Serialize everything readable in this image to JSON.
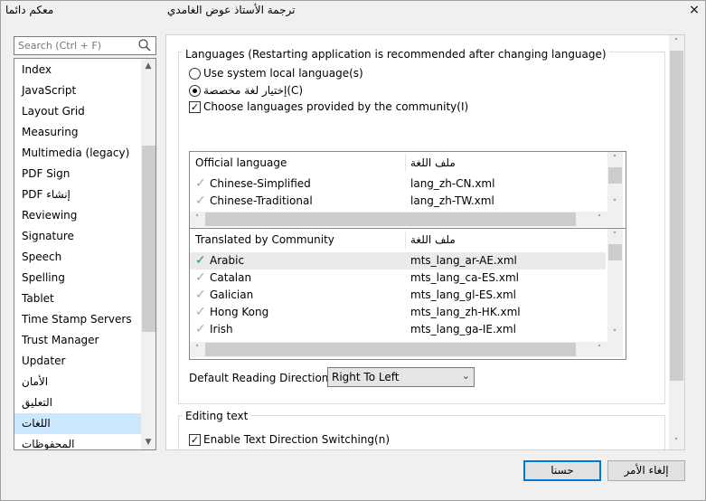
{
  "titlebar": {
    "left_title": "معكم دائما",
    "center_title": "ترجمة الأستاذ عوض الغامدي",
    "close_label": "×"
  },
  "search": {
    "placeholder": "Search (Ctrl + F)"
  },
  "nav": {
    "items": [
      {
        "label": "Index",
        "selected": false
      },
      {
        "label": "JavaScript",
        "selected": false
      },
      {
        "label": "Layout Grid",
        "selected": false
      },
      {
        "label": "Measuring",
        "selected": false
      },
      {
        "label": "Multimedia (legacy)",
        "selected": false
      },
      {
        "label": "PDF Sign",
        "selected": false
      },
      {
        "label": "PDF إنشاء",
        "selected": false
      },
      {
        "label": "Reviewing",
        "selected": false
      },
      {
        "label": "Signature",
        "selected": false
      },
      {
        "label": "Speech",
        "selected": false
      },
      {
        "label": "Spelling",
        "selected": false
      },
      {
        "label": "Tablet",
        "selected": false
      },
      {
        "label": "Time Stamp Servers",
        "selected": false
      },
      {
        "label": "Trust Manager",
        "selected": false
      },
      {
        "label": "Updater",
        "selected": false
      },
      {
        "label": "الأمان",
        "selected": false
      },
      {
        "label": "التعليق",
        "selected": false
      },
      {
        "label": "اللغات",
        "selected": true
      },
      {
        "label": "المحفوظات",
        "selected": false
      }
    ]
  },
  "languages": {
    "group_title": "Languages (Restarting application is recommended after changing language)",
    "radio_system": {
      "label": "Use system local language(s)",
      "checked": false
    },
    "radio_custom": {
      "label": "إختيار لغة مخصصة(C)",
      "checked": true
    },
    "check_community": {
      "label": "Choose languages provided by the community(I)",
      "checked": true
    },
    "official_table": {
      "headers": [
        "Official language",
        "ملف اللغة"
      ],
      "rows": [
        {
          "language": "Chinese-Simplified",
          "file": "lang_zh-CN.xml",
          "check": "gray"
        },
        {
          "language": "Chinese-Traditional",
          "file": "lang_zh-TW.xml",
          "check": "gray"
        }
      ]
    },
    "community_table": {
      "headers": [
        "Translated by Community",
        "ملف اللغة"
      ],
      "rows": [
        {
          "language": "Arabic",
          "file": "mts_lang_ar-AE.xml",
          "check": "green"
        },
        {
          "language": "Catalan",
          "file": "mts_lang_ca-ES.xml",
          "check": "gray"
        },
        {
          "language": "Galician",
          "file": "mts_lang_gl-ES.xml",
          "check": "gray"
        },
        {
          "language": "Hong Kong",
          "file": "mts_lang_zh-HK.xml",
          "check": "gray"
        },
        {
          "language": "Irish",
          "file": "mts_lang_ga-IE.xml",
          "check": "gray"
        }
      ]
    },
    "reading_direction": {
      "label": "Default Reading Direction:",
      "value": "Right To Left"
    }
  },
  "editing": {
    "group_title": "Editing text",
    "check_direction": {
      "label": "Enable Text Direction Switching(n)",
      "checked": true
    }
  },
  "buttons": {
    "ok": "حسنا",
    "cancel": "إلغاء الأمر"
  },
  "colors": {
    "selection": "#cce8ff",
    "default_button_border": "#0078d7",
    "check_green": "#1f9c3a"
  }
}
